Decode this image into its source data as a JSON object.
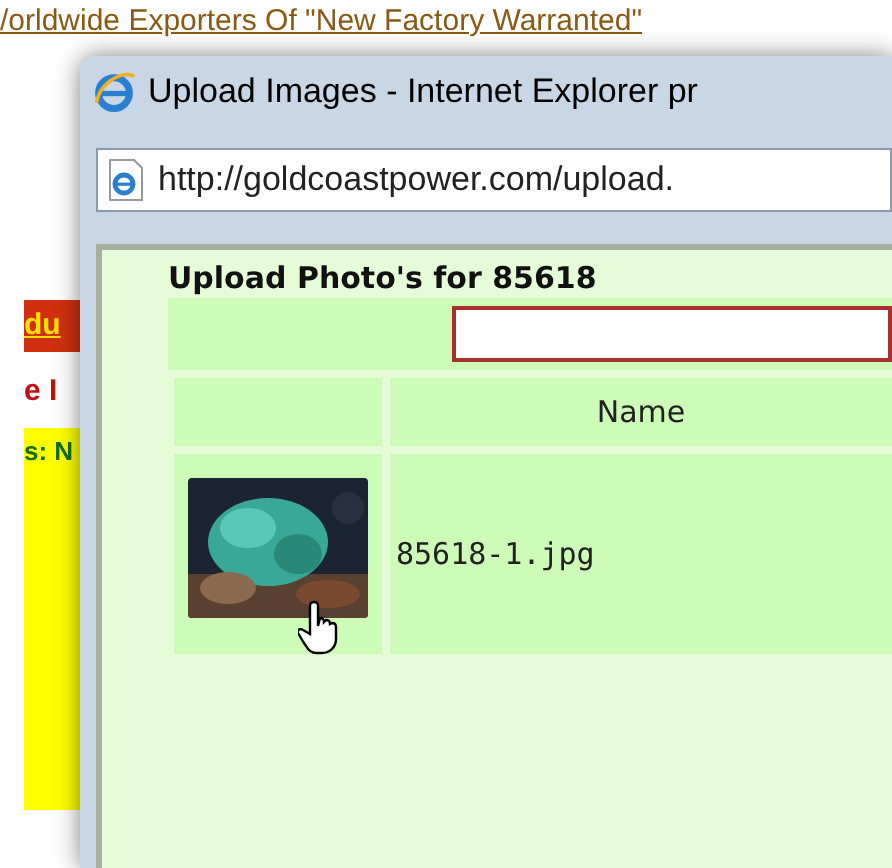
{
  "background_page": {
    "headline": "/orldwide Exporters Of \"New Factory Warranted\"",
    "fragments": [
      {
        "kind": "link",
        "text": "du"
      },
      {
        "kind": "red",
        "text": "e I"
      },
      {
        "kind": "green",
        "text": "s: N"
      }
    ]
  },
  "window": {
    "title": "Upload Images - Internet Explorer pr",
    "address": "http://goldcoastpower.com/upload."
  },
  "upload": {
    "heading": "Upload Photo's for 85618",
    "table": {
      "name_header": "Name",
      "rows": [
        {
          "name": "85618-1.jpg"
        }
      ]
    }
  }
}
